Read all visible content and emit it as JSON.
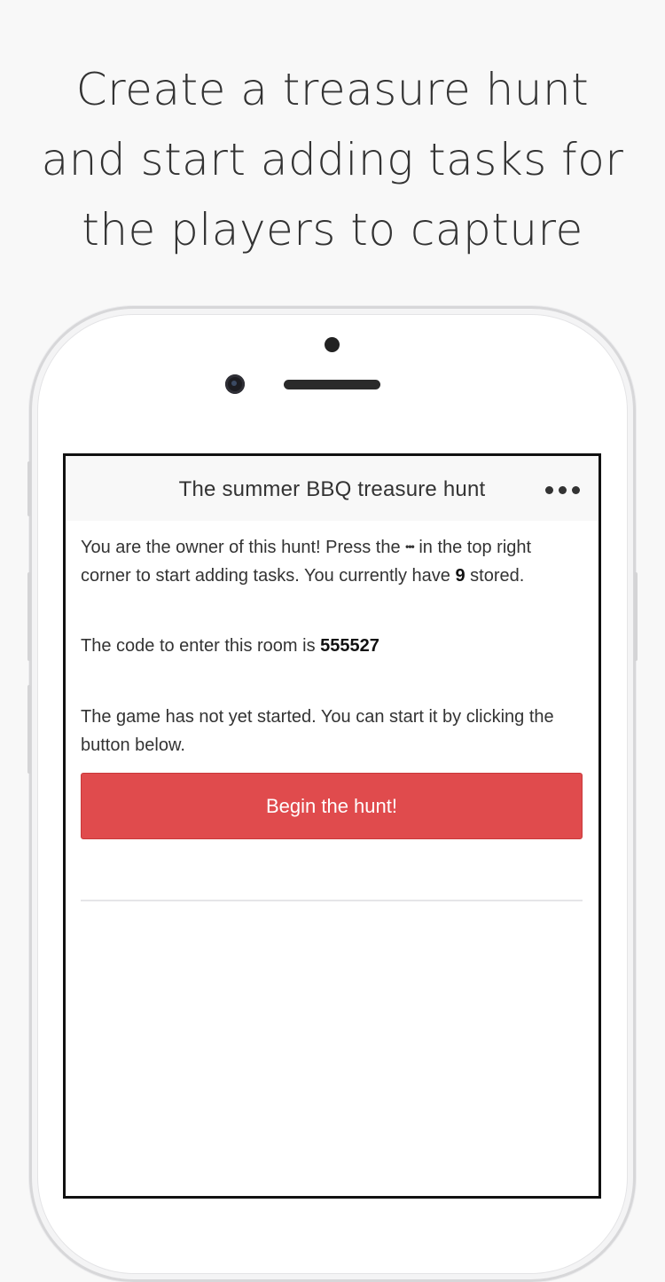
{
  "headline": {
    "line1": "Create a treasure hunt",
    "line2": "and start adding tasks for",
    "line3": "the players to capture"
  },
  "app": {
    "title": "The summer BBQ treasure hunt",
    "more_icon": "more-horizontal-icon"
  },
  "owner_notice": {
    "text_before": "You are the owner of this hunt! Press the ",
    "dots": "•••",
    "text_after": " in the top right corner to start adding tasks. You currently have ",
    "task_count": "9",
    "text_end": " stored."
  },
  "room": {
    "label": "The code to enter this room is ",
    "code": "555527"
  },
  "game_status": {
    "text": "The game has not yet started. You can start it by clicking the button below."
  },
  "actions": {
    "begin_label": "Begin the hunt!"
  },
  "colors": {
    "accent": "#e04b4d",
    "background": "#f8f8f8",
    "text": "#333333"
  }
}
